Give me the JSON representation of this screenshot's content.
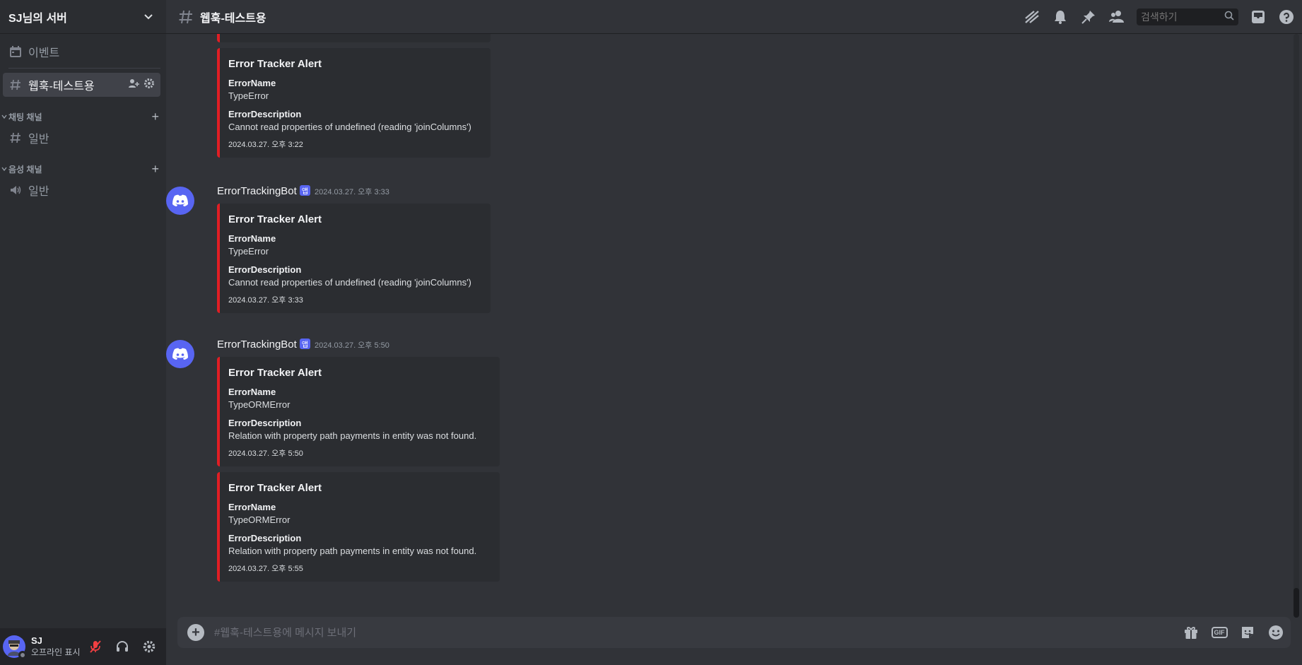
{
  "server": {
    "name": "SJ님의 서버"
  },
  "sidebar": {
    "events_label": "이벤트",
    "active_channel": "웹훅-테스트용",
    "categories": [
      {
        "label": "채팅 채널",
        "channel": "일반",
        "icon": "hash-icon"
      },
      {
        "label": "음성 채널",
        "channel": "일반",
        "icon": "speaker-icon"
      }
    ]
  },
  "user": {
    "name": "SJ",
    "status": "오프라인 표시"
  },
  "header": {
    "channel_title": "웹훅-테스트용",
    "search_placeholder": "검색하기"
  },
  "messages": [
    {
      "continuation": true,
      "embed": {
        "title": "Error Tracker Alert",
        "fields": [
          {
            "name": "ErrorName",
            "value": "TypeError"
          },
          {
            "name": "ErrorDescription",
            "value": "Cannot read properties of undefined (reading 'joinColumns')"
          }
        ],
        "footer": "2024.03.27. 오후 3:22"
      }
    },
    {
      "author": "ErrorTrackingBot",
      "tag": "앱",
      "time": "2024.03.27. 오후 3:33",
      "embed": {
        "title": "Error Tracker Alert",
        "fields": [
          {
            "name": "ErrorName",
            "value": "TypeError"
          },
          {
            "name": "ErrorDescription",
            "value": "Cannot read properties of undefined (reading 'joinColumns')"
          }
        ],
        "footer": "2024.03.27. 오후 3:33"
      }
    },
    {
      "author": "ErrorTrackingBot",
      "tag": "앱",
      "time": "2024.03.27. 오후 5:50",
      "embed": {
        "title": "Error Tracker Alert",
        "fields": [
          {
            "name": "ErrorName",
            "value": "TypeORMError"
          },
          {
            "name": "ErrorDescription",
            "value": "Relation with property path payments in entity was not found."
          }
        ],
        "footer": "2024.03.27. 오후 5:50"
      }
    },
    {
      "continuation": true,
      "embed": {
        "title": "Error Tracker Alert",
        "fields": [
          {
            "name": "ErrorName",
            "value": "TypeORMError"
          },
          {
            "name": "ErrorDescription",
            "value": "Relation with property path payments in entity was not found."
          }
        ],
        "footer": "2024.03.27. 오후 5:55"
      }
    }
  ],
  "composer": {
    "placeholder": "#웹훅-테스트용에 메시지 보내기",
    "gif_label": "GIF"
  },
  "colors": {
    "embed_accent": "#e01e24",
    "brand": "#5865f2",
    "muted": "#f23f42"
  }
}
